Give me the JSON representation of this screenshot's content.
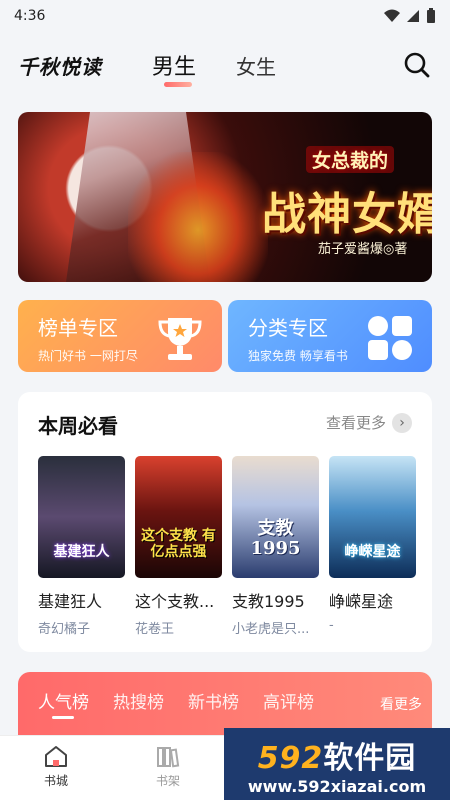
{
  "status_bar": {
    "time": "4:36"
  },
  "header": {
    "app_name": "千秋悦读",
    "tabs": [
      {
        "label": "男生",
        "active": true
      },
      {
        "label": "女生",
        "active": false
      }
    ]
  },
  "banner": {
    "title": "战神女婿",
    "subtitle": "女总裁的",
    "author": "茄子爱酱爆◎著"
  },
  "cards": {
    "rank": {
      "title": "榜单专区",
      "subtitle": "热门好书 一网打尽"
    },
    "category": {
      "title": "分类专区",
      "subtitle": "独家免费 畅享看书"
    }
  },
  "weekly": {
    "title": "本周必看",
    "more_label": "查看更多",
    "books": [
      {
        "title": "基建狂人",
        "author": "奇幻橘子",
        "cover_text": "基建狂人"
      },
      {
        "title": "这个支教...",
        "author": "花卷王",
        "cover_text": "这个支教 有亿点点强"
      },
      {
        "title": "支教1995",
        "author": "小老虎是只...",
        "cover_text": "支教 1995"
      },
      {
        "title": "峥嵘星途",
        "author": "-",
        "cover_text": "峥嵘星途"
      }
    ]
  },
  "ranking": {
    "tabs": [
      "人气榜",
      "热搜榜",
      "新书榜",
      "高评榜"
    ],
    "more_label": "看更多"
  },
  "bottom_nav": {
    "items": [
      {
        "label": "书城",
        "active": true
      },
      {
        "label": "书架",
        "active": false
      }
    ]
  },
  "watermark": {
    "brand_num": "592",
    "brand_text": "软件园",
    "url": "www.592xiazai.com"
  },
  "colors": {
    "accent_red": "#ff6a6a",
    "card_orange": "#ffb14d",
    "card_blue": "#5d9cff"
  }
}
